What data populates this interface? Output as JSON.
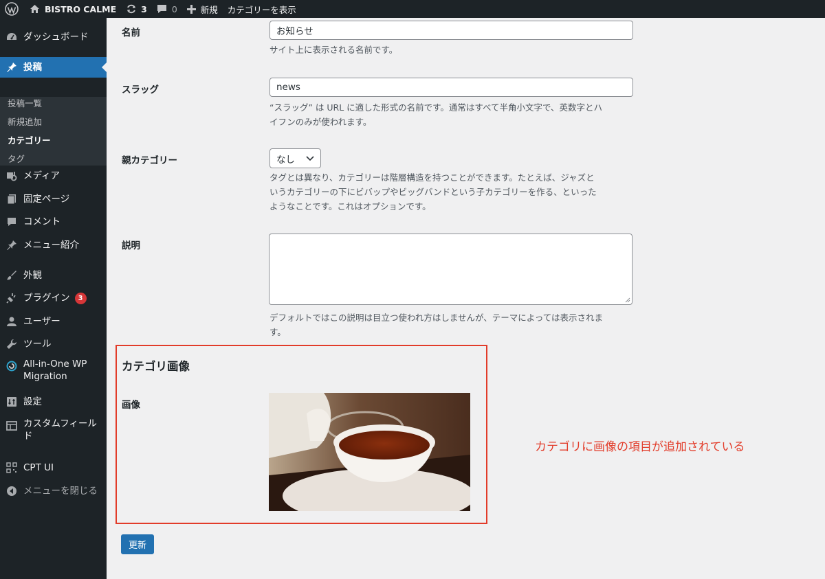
{
  "admin_bar": {
    "site_name": "BISTRO CALME",
    "updates_count": "3",
    "comments_count": "0",
    "new_label": "新規",
    "view_label": "カテゴリーを表示"
  },
  "sidebar": {
    "dashboard": "ダッシュボード",
    "posts": "投稿",
    "posts_submenu": [
      "投稿一覧",
      "新規追加",
      "カテゴリー",
      "タグ"
    ],
    "media": "メディア",
    "pages": "固定ページ",
    "comments": "コメント",
    "menu_intro": "メニュー紹介",
    "appearance": "外観",
    "plugins": "プラグイン",
    "plugins_badge": "3",
    "users": "ユーザー",
    "tools": "ツール",
    "migration_line1": "All-in-One WP",
    "migration_line2": "Migration",
    "settings": "設定",
    "custom_fields_line1": "カスタムフィール",
    "custom_fields_line2": "ド",
    "cpt_ui": "CPT UI",
    "collapse": "メニューを閉じる"
  },
  "form": {
    "name": {
      "label": "名前",
      "value": "お知らせ",
      "description": "サイト上に表示される名前です。"
    },
    "slug": {
      "label": "スラッグ",
      "value": "news",
      "description_line1": "“スラッグ” は URL に適した形式の名前です。通常はすべて半角小文字で、英数字とハ",
      "description_line2": "イフンのみが使われます。"
    },
    "parent": {
      "label": "親カテゴリー",
      "selected": "なし",
      "description_line1": "タグとは異なり、カテゴリーは階層構造を持つことができます。たとえば、ジャズと",
      "description_line2": "いうカテゴリーの下にビバップやビッグバンドという子カテゴリーを作る、といった",
      "description_line3": "ようなことです。これはオプションです。"
    },
    "description": {
      "label": "説明",
      "value": "",
      "description_line1": "デフォルトではこの説明は目立つ使われ方はしませんが、テーマによっては表示されま",
      "description_line2": "す。"
    },
    "category_image": {
      "section_title": "カテゴリ画像",
      "label": "画像"
    },
    "submit_label": "更新"
  },
  "annotation": {
    "text": "カテゴリに画像の項目が追加されている",
    "color": "#e23c2a"
  },
  "colors": {
    "admin_bg": "#1d2327",
    "accent": "#2271b1",
    "badge": "#d63638"
  }
}
